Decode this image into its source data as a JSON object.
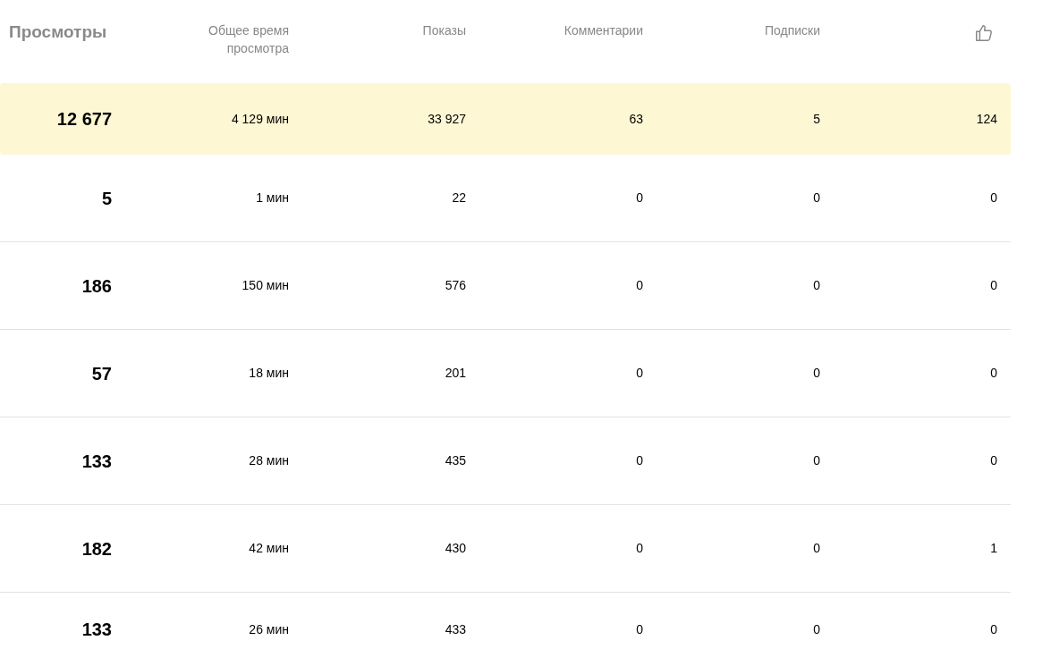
{
  "columns": [
    {
      "kind": "text",
      "label": "Просмотры"
    },
    {
      "kind": "text",
      "label": "Общее время просмотра"
    },
    {
      "kind": "text",
      "label": "Показы"
    },
    {
      "kind": "text",
      "label": "Комментарии"
    },
    {
      "kind": "text",
      "label": "Подписки"
    },
    {
      "kind": "icon"
    }
  ],
  "rows": [
    {
      "highlighted": true,
      "cells": [
        "12 677",
        "4 129 мин",
        "33 927",
        "63",
        "5",
        "124"
      ]
    },
    {
      "highlighted": false,
      "cells": [
        "5",
        "1 мин",
        "22",
        "0",
        "0",
        "0"
      ]
    },
    {
      "highlighted": false,
      "cells": [
        "186",
        "150 мин",
        "576",
        "0",
        "0",
        "0"
      ]
    },
    {
      "highlighted": false,
      "cells": [
        "57",
        "18 мин",
        "201",
        "0",
        "0",
        "0"
      ]
    },
    {
      "highlighted": false,
      "cells": [
        "133",
        "28 мин",
        "435",
        "0",
        "0",
        "0"
      ]
    },
    {
      "highlighted": false,
      "cells": [
        "182",
        "42 мин",
        "430",
        "0",
        "0",
        "1"
      ]
    },
    {
      "highlighted": false,
      "cells": [
        "133",
        "26 мин",
        "433",
        "0",
        "0",
        "0"
      ]
    }
  ]
}
